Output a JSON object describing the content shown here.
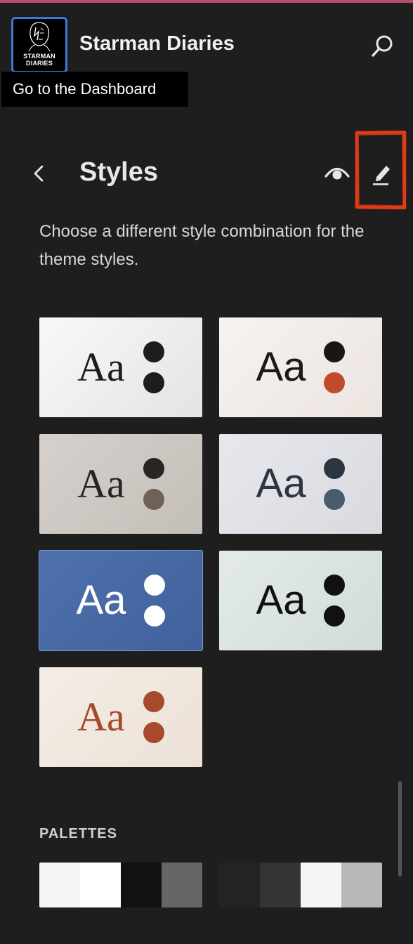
{
  "site": {
    "title": "Starman Diaries",
    "logo_line1": "STARMAN",
    "logo_line2": "DIARIES"
  },
  "tooltip": "Go to the Dashboard",
  "panel": {
    "title": "Styles",
    "description": "Choose a different style combination for the theme styles."
  },
  "variations": [
    {
      "sample": "Aa",
      "font": "serif",
      "bg": "linear-gradient(135deg,#f8f8f8,#e4e4e4)",
      "text": "#1d1d1d",
      "dot1": "#1d1d1d",
      "dot2": "#1d1d1d",
      "selected": false
    },
    {
      "sample": "Aa",
      "font": "sans",
      "bg": "linear-gradient(135deg,#f6f3f1,#ece4df)",
      "text": "#1a1a1a",
      "dot1": "#1a1614",
      "dot2": "#c04a2b",
      "selected": false
    },
    {
      "sample": "Aa",
      "font": "serif",
      "bg": "linear-gradient(135deg,#d6d1cc,#c4beb9)",
      "text": "#2a2522",
      "dot1": "#2a2522",
      "dot2": "#6e6258",
      "selected": false
    },
    {
      "sample": "Aa",
      "font": "sans",
      "bg": "linear-gradient(135deg,#e7e8ed,#d9dae0)",
      "text": "#2c3640",
      "dot1": "#2c3640",
      "dot2": "#4a5c6b",
      "selected": false
    },
    {
      "sample": "Aa",
      "font": "sans",
      "bg": "linear-gradient(135deg,#4e70ac,#40619c)",
      "text": "#ffffff",
      "dot1": "#ffffff",
      "dot2": "#ffffff",
      "selected": true
    },
    {
      "sample": "Aa",
      "font": "sans",
      "bg": "linear-gradient(135deg,#e4ebe7,#d1dcd7)",
      "text": "#111111",
      "dot1": "#111111",
      "dot2": "#111111",
      "selected": false
    },
    {
      "sample": "Aa",
      "font": "serif",
      "bg": "linear-gradient(135deg,#f4ede6,#ece1d6)",
      "text": "#a6492d",
      "dot1": "#a6492d",
      "dot2": "#a6492d",
      "selected": false
    }
  ],
  "palettes_heading": "PALETTES",
  "palettes": [
    {
      "colors": [
        "#f5f5f5",
        "#ffffff",
        "#111111",
        "#666666"
      ]
    },
    {
      "colors": [
        "#232323",
        "#343434",
        "#f5f5f5",
        "#b8b8b8"
      ]
    }
  ],
  "icons": {
    "logo": "starman-face-icon",
    "search": "search-icon",
    "back": "chevron-left-icon",
    "preview": "eye-icon",
    "edit": "pencil-icon"
  },
  "colors": {
    "sidebar_bg": "#1e1e1e",
    "accent": "#3b7bd6",
    "highlight": "#e53a17"
  }
}
